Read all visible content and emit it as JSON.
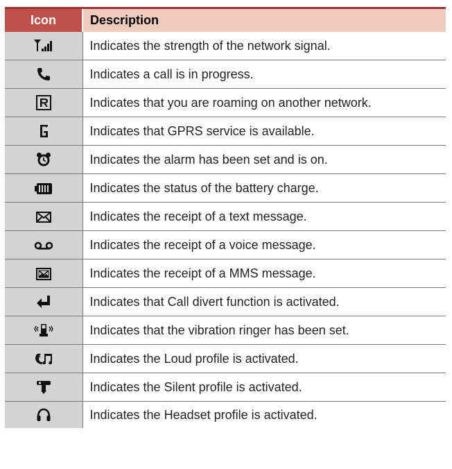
{
  "header": {
    "icon_col": "Icon",
    "desc_col": "Description"
  },
  "rows": [
    {
      "icon": "signal-strength-icon",
      "description": "Indicates the strength of the network signal."
    },
    {
      "icon": "phone-call-icon",
      "description": "Indicates a call is in progress."
    },
    {
      "icon": "roaming-icon",
      "description": "Indicates that you are roaming on another network."
    },
    {
      "icon": "gprs-icon",
      "description": "Indicates that GPRS service is available."
    },
    {
      "icon": "alarm-icon",
      "description": "Indicates the alarm has been set and is on."
    },
    {
      "icon": "battery-icon",
      "description": "Indicates the status of the battery charge."
    },
    {
      "icon": "envelope-icon",
      "description": "Indicates the receipt of a text message."
    },
    {
      "icon": "voicemail-icon",
      "description": "Indicates the receipt of a voice message."
    },
    {
      "icon": "mms-icon",
      "description": "Indicates the receipt of a MMS message."
    },
    {
      "icon": "call-divert-icon",
      "description": "Indicates that Call divert function is activated."
    },
    {
      "icon": "vibration-icon",
      "description": "Indicates that the vibration ringer has been set."
    },
    {
      "icon": "loud-profile-icon",
      "description": "Indicates the Loud profile is activated."
    },
    {
      "icon": "silent-profile-icon",
      "description": "Indicates the Silent profile is activated."
    },
    {
      "icon": "headset-icon",
      "description": "Indicates the Headset profile is activated."
    }
  ]
}
